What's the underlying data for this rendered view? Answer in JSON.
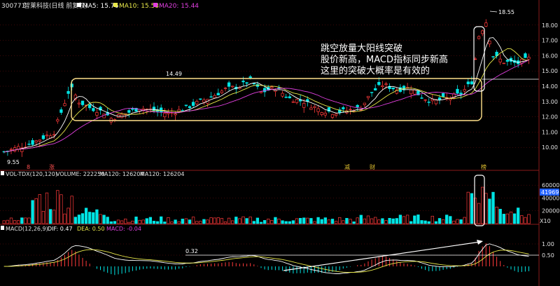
{
  "header": {
    "code": "300771",
    "name": "智莱科技(日线 前复权)",
    "ma5_label": "MA5: 15.76",
    "ma10_label": "MA10: 15.58",
    "ma20_label": "MA20: 15.44"
  },
  "volume_header": {
    "prefix": "VOL-TDX(120,120)",
    "volume_label": "VOLUME: 222250",
    "ma1_label": "MA120: 126204",
    "ma2_label": "MA120: 126204"
  },
  "macd_header": {
    "prefix": "MACD(12,26,9)",
    "dif_label": "DIF: 0.47",
    "dea_label": "DEA: 0.50",
    "macd_label": "MACD: -0.04"
  },
  "annotation": {
    "line1": "跳空放量大阳线突破",
    "line2": "股价新高，MACD指标同步新高",
    "line3": "这里的突破大概率是有效的"
  },
  "markers": {
    "high": "18.55",
    "low": "9.55",
    "range_top": "14.49",
    "macd_level": "0.32",
    "vol_current": "41969",
    "unit": "X10",
    "m1": "8",
    "m2": "涨",
    "m3": "减",
    "m4": "财",
    "m5": "榜"
  },
  "colors": {
    "up": "#ff3a3a",
    "down": "#00e5e5",
    "ma5": "#ffffff",
    "ma10": "#e8e84a",
    "ma20": "#e040e0",
    "box": "#ffe08a",
    "grid": "#7a1010"
  },
  "chart_data": [
    {
      "type": "candlestick",
      "title": "300771 智莱科技(日线 前复权)",
      "ylim": [
        9.0,
        19.0
      ],
      "yticks": [
        "18.00",
        "17.00",
        "16.00",
        "15.00",
        "14.00",
        "13.00",
        "12.00",
        "11.00",
        "10.00"
      ],
      "series": [
        {
          "name": "MA5",
          "last": 15.76
        },
        {
          "name": "MA10",
          "last": 15.58
        },
        {
          "name": "MA20",
          "last": 15.44
        }
      ],
      "annotations": [
        "18.55",
        "14.49",
        "9.55"
      ]
    },
    {
      "type": "bar",
      "title": "VOL-TDX(120,120)",
      "yticks": [
        "60000",
        "40000",
        "20000"
      ],
      "current": 222250
    },
    {
      "type": "line",
      "title": "MACD(12,26,9)",
      "yticks": [
        "1.00",
        "0.50"
      ],
      "series": [
        {
          "name": "DIF",
          "last": 0.47
        },
        {
          "name": "DEA",
          "last": 0.5
        },
        {
          "name": "MACD",
          "last": -0.04
        }
      ]
    }
  ]
}
